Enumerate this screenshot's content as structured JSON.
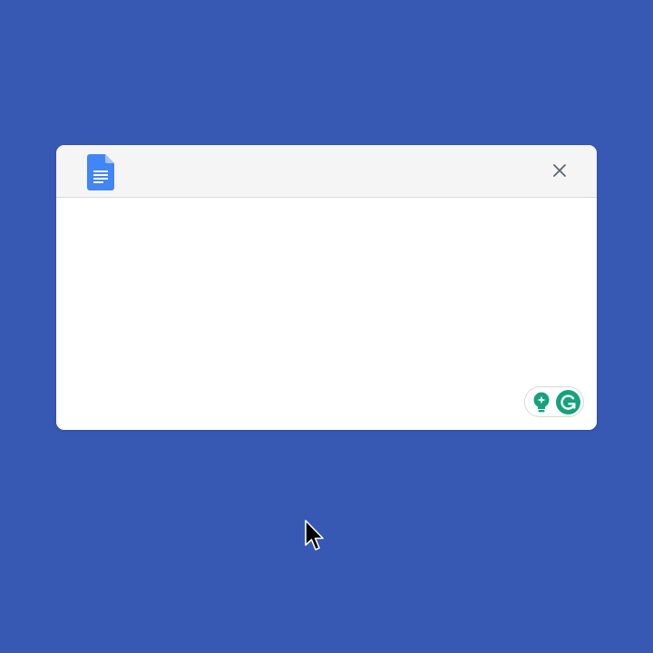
{
  "window": {
    "app_icon": "google-docs-icon",
    "close_icon": "close-icon"
  },
  "grammarly": {
    "suggestions_icon": "lightbulb-icon",
    "logo_icon": "grammarly-g-icon",
    "brand_color": "#15A27C"
  },
  "colors": {
    "background": "#3759B4",
    "docs_blue": "#4285F4"
  },
  "pointer": {
    "icon": "mouse-pointer-icon"
  }
}
